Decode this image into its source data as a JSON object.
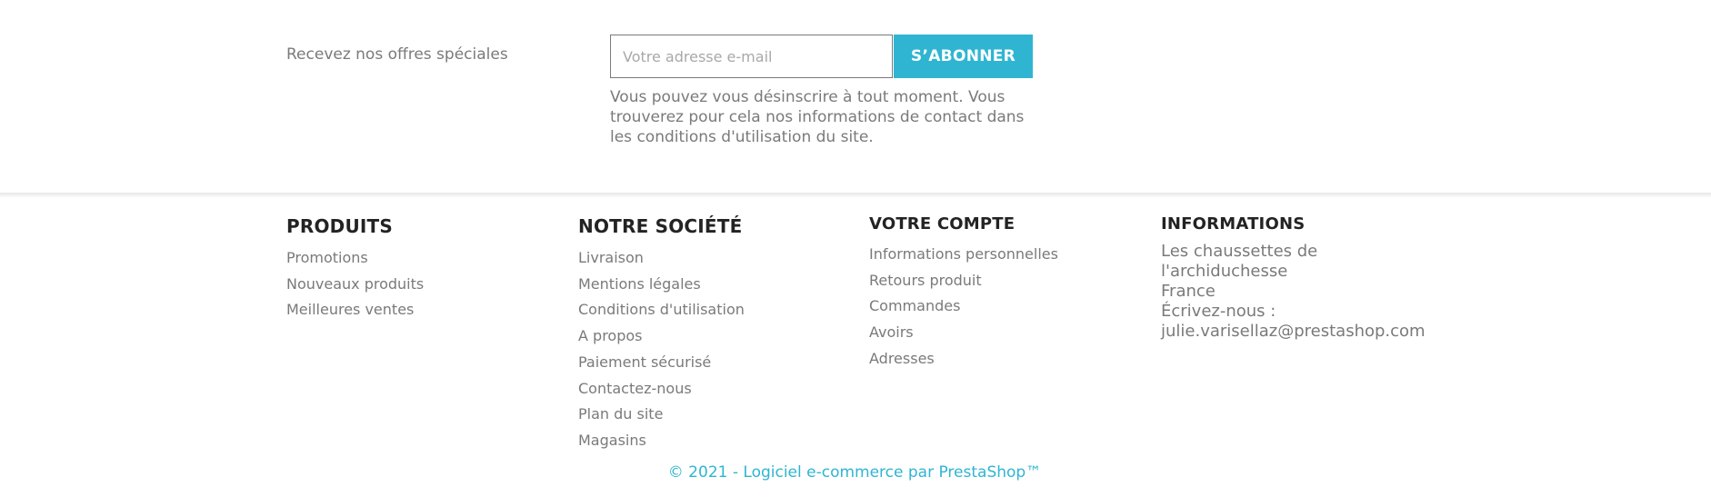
{
  "newsletter": {
    "label": "Recevez nos offres spéciales",
    "email_placeholder": "Votre adresse e-mail",
    "subscribe_label": "S’ABONNER",
    "note": "Vous pouvez vous désinscrire à tout moment. Vous trouverez pour cela nos informations de contact dans les conditions d'utilisation du site."
  },
  "footer": {
    "produits": {
      "title": "PRODUITS",
      "links": [
        "Promotions",
        "Nouveaux produits",
        "Meilleures ventes"
      ]
    },
    "societe": {
      "title": "NOTRE SOCIÉTÉ",
      "links": [
        "Livraison",
        "Mentions légales",
        "Conditions d'utilisation",
        "A propos",
        "Paiement sécurisé",
        "Contactez-nous",
        "Plan du site",
        "Magasins"
      ]
    },
    "compte": {
      "title": "VOTRE COMPTE",
      "links": [
        "Informations personnelles",
        "Retours produit",
        "Commandes",
        "Avoirs",
        "Adresses"
      ]
    },
    "informations": {
      "title": "INFORMATIONS",
      "lines": [
        "Les chaussettes de",
        "l'archiduchesse",
        "France",
        "Écrivez-nous :",
        "julie.varisellaz@prestashop.com"
      ]
    }
  },
  "copyright": "© 2021 - Logiciel e-commerce par PrestaShop™",
  "colors": {
    "accent": "#2fb5d2",
    "heading": "#232323",
    "text": "#7a7a7a"
  }
}
